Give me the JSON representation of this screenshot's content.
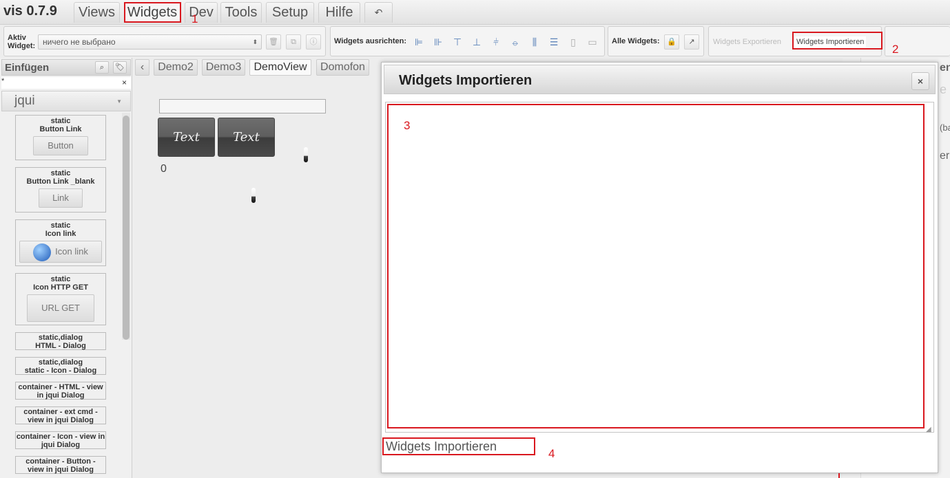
{
  "app": {
    "title": "vis 0.7.9"
  },
  "menu": {
    "tabs": [
      "Views",
      "Widgets",
      "Dev",
      "Tools",
      "Setup",
      "Hilfe"
    ]
  },
  "annotations": {
    "marks": [
      "1",
      "2",
      "3",
      "4"
    ],
    "color": "#d9171e"
  },
  "toolbar": {
    "active_widget_label": "Aktiv Widget:",
    "active_widget_line1": "Aktiv",
    "active_widget_line2": "Widget:",
    "active_widget_value": "ничего не выбрано",
    "align_label": "Widgets ausrichten:",
    "all_widgets_label": "Alle Widgets:",
    "export_label": "Widgets Exportieren",
    "import_label": "Widgets Importieren"
  },
  "sidebar": {
    "title": "Einfügen",
    "filter_value": "*",
    "clear_icon": "×",
    "widget_set": "jqui",
    "widgets": [
      {
        "title1": "static",
        "title2": "Button Link",
        "button": "Button"
      },
      {
        "title1": "static",
        "title2": "Button Link _blank",
        "button": "Link"
      },
      {
        "title1": "static",
        "title2": "Icon link",
        "button": "Icon link"
      },
      {
        "title1": "static",
        "title2": "Icon HTTP GET",
        "button": "URL GET"
      },
      {
        "title1": "static,dialog",
        "title2": "HTML - Dialog"
      },
      {
        "title1": "static,dialog",
        "title2": "static - Icon - Dialog"
      },
      {
        "title1": "container - HTML - view",
        "title2": "in jqui Dialog"
      },
      {
        "title1": "container - ext cmd -",
        "title2": "view in jqui Dialog"
      },
      {
        "title1": "container - Icon - view in",
        "title2": "jqui Dialog"
      },
      {
        "title1": "container - Button -",
        "title2": "view in jqui Dialog"
      }
    ]
  },
  "views": {
    "nav_prev": "‹",
    "tabs": [
      "Demo2",
      "Demo3",
      "DemoView",
      "Domofon"
    ],
    "active": "DemoView"
  },
  "canvas": {
    "text_button_1": "Text",
    "text_button_2": "Text",
    "value": "0"
  },
  "right_panel": {
    "fragments": [
      "en",
      "e",
      "(ba",
      "er"
    ]
  },
  "dialog": {
    "title": "Widgets Importieren",
    "close_icon": "×",
    "textarea_value": "",
    "import_button": "Widgets Importieren"
  }
}
